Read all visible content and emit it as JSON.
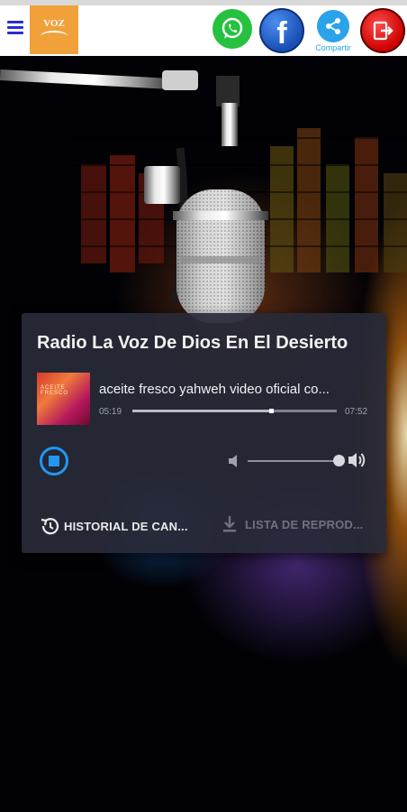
{
  "header": {
    "logo_text": "VOZ",
    "share_caption": "Compartir",
    "icons": [
      "menu-icon",
      "whatsapp-icon",
      "facebook-icon",
      "share-icon",
      "exit-icon"
    ],
    "colors": {
      "whatsapp": "#25c13f",
      "facebook": "#1a4fb5",
      "share": "#2aa3ea",
      "exit": "#cc0000",
      "logo_bg": "#f0a13a",
      "menu": "#2b2bd1"
    }
  },
  "player": {
    "station_title": "Radio La Voz De Dios En El Desierto",
    "track_title": "aceite fresco yahweh video oficial co...",
    "time_elapsed": "05:19",
    "time_total": "07:52",
    "progress_fraction": 0.68,
    "volume_fraction": 0.95,
    "state": "playing",
    "cover_text": "ACEITE FRESCO",
    "accent_color": "#2196f3",
    "history_label": "HISTORIAL DE CAN...",
    "playlist_label": "LISTA DE REPROD..."
  }
}
